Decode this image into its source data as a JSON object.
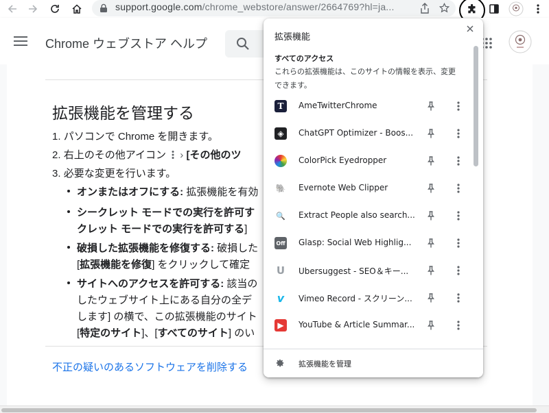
{
  "browser": {
    "url_main": "support.google.com",
    "url_path": "/chrome_webstore/answer/2664769?hl=ja..."
  },
  "help_header": {
    "title": "Chrome ウェブストア ヘルプ"
  },
  "article": {
    "title": "拡張機能を管理する",
    "steps": [
      {
        "num": "1.",
        "text": "パソコンで Chrome を開きます。"
      },
      {
        "num": "2.",
        "text_a": "右上のその他アイコン",
        "sep": "›",
        "text_b": "[その他のツ"
      },
      {
        "num": "3.",
        "text": "必要な変更を行います。"
      }
    ],
    "bullets": [
      {
        "bold": "オンまたはオフにする:",
        "text": "拡張機能を有効"
      },
      {
        "bold": "シークレット モードでの実行を許可す",
        "text": ""
      },
      {
        "bold": "クレット モードでの実行を許可する",
        "text": "]"
      },
      {
        "bold": "破損した拡張機能を修復する:",
        "text": "破損した"
      },
      {
        "pre": "[",
        "bold": "拡張機能を修復",
        "text": "] をクリックして確定"
      },
      {
        "bold": "サイトへのアクセスを許可する:",
        "text": "該当の"
      },
      {
        "text": "したウェブサイト上にある自分の全デ"
      },
      {
        "text": "します] の横で、この拡張機能のサイト"
      },
      {
        "pre": "[",
        "bold": "特定のサイト",
        "text": "]、[",
        "bold2": "すべてのサイト",
        "text2": "] のい"
      }
    ],
    "link": "不正の疑いのあるソフトウェアを削除する"
  },
  "popup": {
    "title": "拡張機能",
    "section_title": "すべてのアクセス",
    "section_desc": "これらの拡張機能は、このサイトの情報を表示、変更できます。",
    "extensions": [
      {
        "name": "AmeTwitterChrome",
        "icon": "T",
        "icon_name": "ametwitter-icon",
        "bg": "#1a1f3a",
        "fg": "#ffffff"
      },
      {
        "name": "ChatGPT Optimizer - Boos...",
        "icon": "◈",
        "icon_name": "chatgpt-optimizer-icon",
        "bg": "#202124",
        "fg": "#ffffff"
      },
      {
        "name": "ColorPick Eyedropper",
        "icon": "",
        "icon_name": "colorpick-icon",
        "bg": "",
        "fg": ""
      },
      {
        "name": "Evernote Web Clipper",
        "icon": "🐘",
        "icon_name": "evernote-icon",
        "bg": "",
        "fg": "#2dbe60"
      },
      {
        "name": "Extract People also search...",
        "icon": "🔍",
        "icon_name": "search-extract-icon",
        "bg": "",
        "fg": "#1a73e8"
      },
      {
        "name": "Glasp: Social Web Highlig...",
        "icon": "Off",
        "icon_name": "glasp-icon",
        "bg": "#5f6368",
        "fg": "#ffffff"
      },
      {
        "name": "Ubersuggest - SEO＆キー...",
        "icon": "U",
        "icon_name": "ubersuggest-icon",
        "bg": "",
        "fg": "#9aa0a6"
      },
      {
        "name": "Vimeo Record - スクリーン...",
        "icon": "v",
        "icon_name": "vimeo-icon",
        "bg": "",
        "fg": "#1ab7ea"
      },
      {
        "name": "YouTube & Article Summar...",
        "icon": "▶",
        "icon_name": "youtube-summary-icon",
        "bg": "#e53935",
        "fg": "#ffffff"
      }
    ],
    "footer_label": "拡張機能を管理"
  },
  "colors": {
    "link": "#1a73e8",
    "scroll_thumb": "#bdc1c6"
  }
}
